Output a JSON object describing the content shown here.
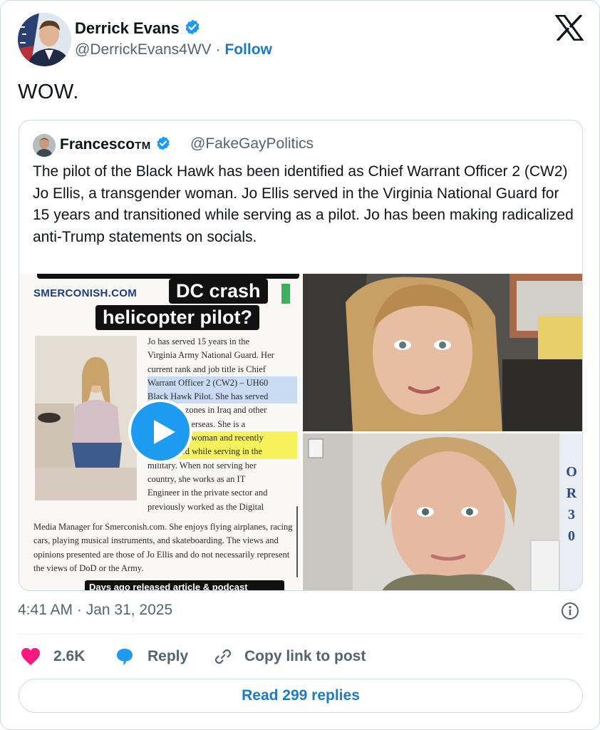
{
  "author": {
    "name": "Derrick Evans",
    "handle": "@DerrickEvans4WV",
    "separator": "·",
    "follow_label": "Follow"
  },
  "tweet_text": "WOW.",
  "quoted": {
    "name": "Francesco",
    "name_suffix": "TM",
    "handle": "@FakeGayPolitics",
    "text": "The pilot of the Black Hawk has been identified as Chief Warrant Officer 2 (CW2) Jo Ellis, a transgender woman. Jo Ellis served in the Virginia National Guard for 15 years and transitioned while serving as a pilot. Jo has been making radicalized anti-Trump statements on socials.",
    "media": {
      "site_name": "SMERCONISH.COM",
      "title_line1": "DC crash",
      "title_line2": "helicopter pilot?",
      "article_lines": [
        "Jo has served 15 years in the",
        "Virginia Army National Guard. Her",
        "current rank and job title is Chief",
        "Warrant Officer 2 (CW2) – UH60",
        "Black Hawk Pilot. She has served",
        "in combat zones in Iraq and other",
        "countries overseas. She is a",
        "transgender woman and recently",
        "transitioned while serving in the",
        "military. When not serving her",
        "country, she works as an IT",
        "Engineer in the private sector and",
        "previously worked as the Digital"
      ],
      "article_bottom": "Media Manager for Smerconish.com. She enjoys flying airplanes, racing cars, playing musical instruments, and skateboarding. The views and opinions presented are those of Jo Ellis and do not necessarily represent the views of DoD or the Army.",
      "caption": "Days ago released article & podcast"
    }
  },
  "timestamp": "4:41 AM · Jan 31, 2025",
  "actions": {
    "like_count": "2.6K",
    "reply_label": "Reply",
    "copy_label": "Copy link to post"
  },
  "read_replies_label": "Read 299 replies",
  "colors": {
    "accent": "#1d7bc2",
    "verified": "#1d9bf0",
    "like": "#f91880",
    "muted": "#536471",
    "border": "#cfd9de"
  }
}
